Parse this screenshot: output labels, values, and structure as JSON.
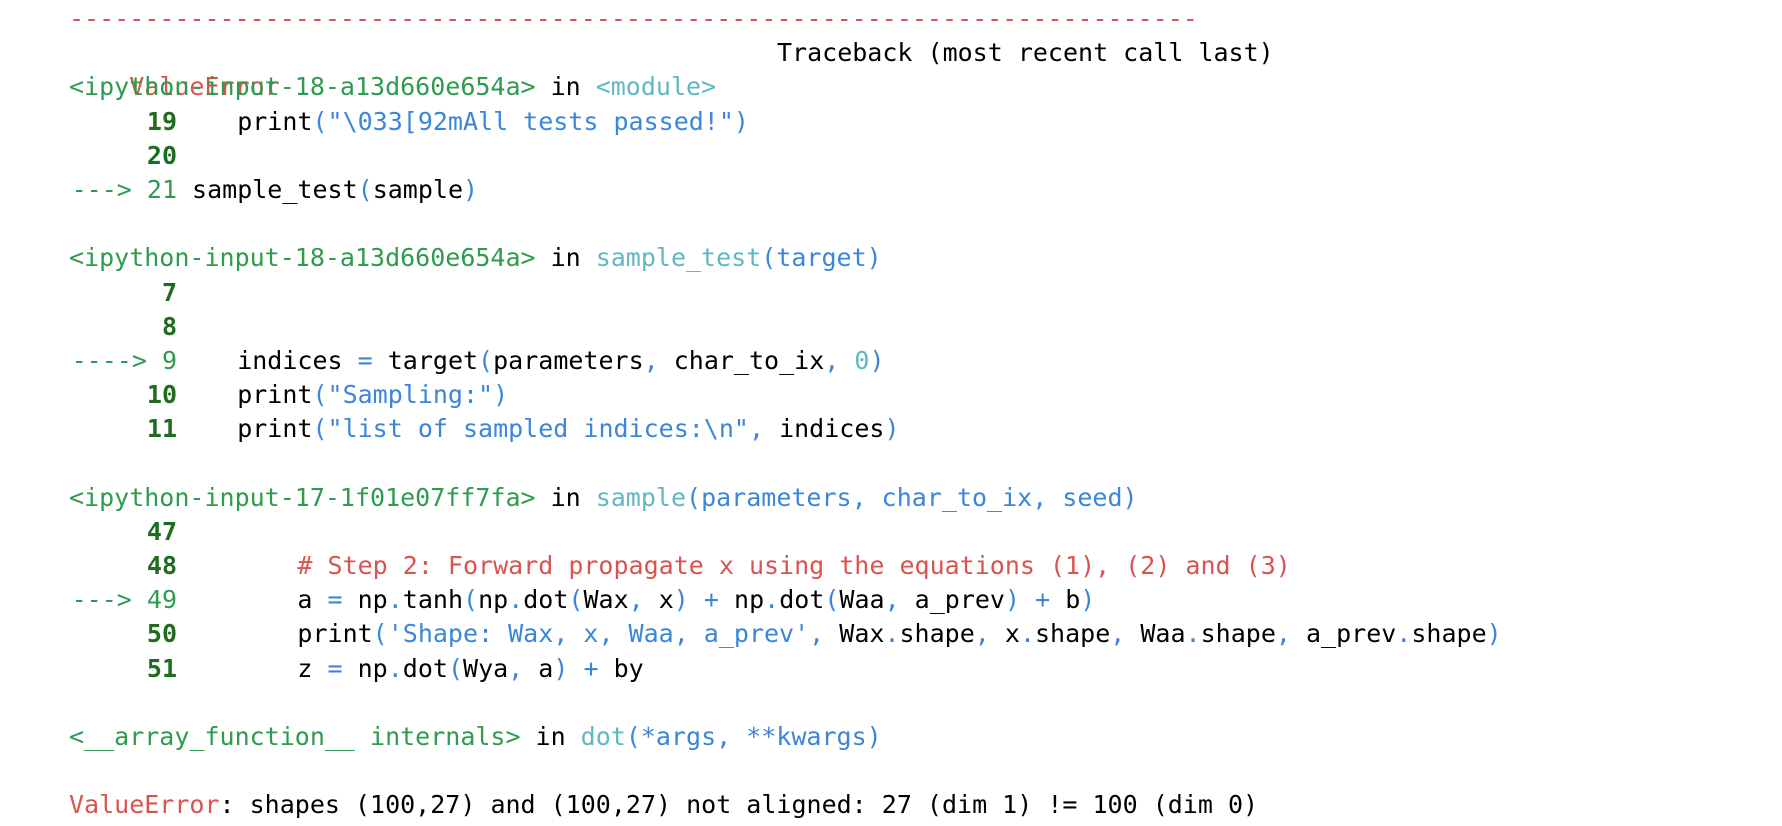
{
  "separator": "---------------------------------------------------------------------------",
  "error_name": "ValueError",
  "traceback_header": "Traceback (most recent call last)",
  "frames": [
    {
      "source": "<ipython-input-18-a13d660e654a>",
      "in_word": "in",
      "function": "<module>",
      "params": "",
      "lines": [
        {
          "arrow": "",
          "num": "19",
          "code": [
            {
              "t": "    print",
              "c": "blk"
            },
            {
              "t": "(\"\\033[92mAll tests passed!\")",
              "c": "blu"
            }
          ]
        },
        {
          "arrow": "",
          "num": "20",
          "code": []
        },
        {
          "arrow": "---> ",
          "num": "21",
          "current": true,
          "code": [
            {
              "t": " sample_test",
              "c": "blk"
            },
            {
              "t": "(",
              "c": "blu"
            },
            {
              "t": "sample",
              "c": "blk"
            },
            {
              "t": ")",
              "c": "blu"
            }
          ]
        }
      ]
    },
    {
      "source": "<ipython-input-18-a13d660e654a>",
      "in_word": "in",
      "function": "sample_test",
      "params": "(target)",
      "lines": [
        {
          "arrow": "",
          "num": "7",
          "code": []
        },
        {
          "arrow": "",
          "num": "8",
          "code": []
        },
        {
          "arrow": "----> ",
          "num": "9",
          "current": true,
          "code": [
            {
              "t": "    indices ",
              "c": "blk"
            },
            {
              "t": "=",
              "c": "blu"
            },
            {
              "t": " target",
              "c": "blk"
            },
            {
              "t": "(",
              "c": "blu"
            },
            {
              "t": "parameters",
              "c": "blk"
            },
            {
              "t": ",",
              "c": "blu"
            },
            {
              "t": " char_to_ix",
              "c": "blk"
            },
            {
              "t": ",",
              "c": "blu"
            },
            {
              "t": " 0",
              "c": "cyn"
            },
            {
              "t": ")",
              "c": "blu"
            }
          ]
        },
        {
          "arrow": "",
          "num": "10",
          "code": [
            {
              "t": "    print",
              "c": "blk"
            },
            {
              "t": "(\"Sampling:\")",
              "c": "blu"
            }
          ]
        },
        {
          "arrow": "",
          "num": "11",
          "code": [
            {
              "t": "    print",
              "c": "blk"
            },
            {
              "t": "(\"list of sampled indices:\\n\",",
              "c": "blu"
            },
            {
              "t": " indices",
              "c": "blk"
            },
            {
              "t": ")",
              "c": "blu"
            }
          ]
        }
      ]
    },
    {
      "source": "<ipython-input-17-1f01e07ff7fa>",
      "in_word": "in",
      "function": "sample",
      "params": "(parameters, char_to_ix, seed)",
      "lines": [
        {
          "arrow": "",
          "num": "47",
          "code": []
        },
        {
          "arrow": "",
          "num": "48",
          "code": [
            {
              "t": "        # Step 2: Forward propagate x using the equations (1), (2) and (3)",
              "c": "red"
            }
          ]
        },
        {
          "arrow": "---> ",
          "num": "49",
          "current": true,
          "code": [
            {
              "t": "        a ",
              "c": "blk"
            },
            {
              "t": "=",
              "c": "blu"
            },
            {
              "t": " np",
              "c": "blk"
            },
            {
              "t": ".",
              "c": "blu"
            },
            {
              "t": "tanh",
              "c": "blk"
            },
            {
              "t": "(",
              "c": "blu"
            },
            {
              "t": "np",
              "c": "blk"
            },
            {
              "t": ".",
              "c": "blu"
            },
            {
              "t": "dot",
              "c": "blk"
            },
            {
              "t": "(",
              "c": "blu"
            },
            {
              "t": "Wax",
              "c": "blk"
            },
            {
              "t": ",",
              "c": "blu"
            },
            {
              "t": " x",
              "c": "blk"
            },
            {
              "t": ")",
              "c": "blu"
            },
            {
              "t": " +",
              "c": "blu"
            },
            {
              "t": " np",
              "c": "blk"
            },
            {
              "t": ".",
              "c": "blu"
            },
            {
              "t": "dot",
              "c": "blk"
            },
            {
              "t": "(",
              "c": "blu"
            },
            {
              "t": "Waa",
              "c": "blk"
            },
            {
              "t": ",",
              "c": "blu"
            },
            {
              "t": " a_prev",
              "c": "blk"
            },
            {
              "t": ")",
              "c": "blu"
            },
            {
              "t": " +",
              "c": "blu"
            },
            {
              "t": " b",
              "c": "blk"
            },
            {
              "t": ")",
              "c": "blu"
            }
          ]
        },
        {
          "arrow": "",
          "num": "50",
          "code": [
            {
              "t": "        print",
              "c": "blk"
            },
            {
              "t": "('Shape: Wax, x, Waa, a_prev',",
              "c": "blu"
            },
            {
              "t": " Wax",
              "c": "blk"
            },
            {
              "t": ".",
              "c": "blu"
            },
            {
              "t": "shape",
              "c": "blk"
            },
            {
              "t": ",",
              "c": "blu"
            },
            {
              "t": " x",
              "c": "blk"
            },
            {
              "t": ".",
              "c": "blu"
            },
            {
              "t": "shape",
              "c": "blk"
            },
            {
              "t": ",",
              "c": "blu"
            },
            {
              "t": " Waa",
              "c": "blk"
            },
            {
              "t": ".",
              "c": "blu"
            },
            {
              "t": "shape",
              "c": "blk"
            },
            {
              "t": ",",
              "c": "blu"
            },
            {
              "t": " a_prev",
              "c": "blk"
            },
            {
              "t": ".",
              "c": "blu"
            },
            {
              "t": "shape",
              "c": "blk"
            },
            {
              "t": ")",
              "c": "blu"
            }
          ]
        },
        {
          "arrow": "",
          "num": "51",
          "code": [
            {
              "t": "        z ",
              "c": "blk"
            },
            {
              "t": "=",
              "c": "blu"
            },
            {
              "t": " np",
              "c": "blk"
            },
            {
              "t": ".",
              "c": "blu"
            },
            {
              "t": "dot",
              "c": "blk"
            },
            {
              "t": "(",
              "c": "blu"
            },
            {
              "t": "Wya",
              "c": "blk"
            },
            {
              "t": ",",
              "c": "blu"
            },
            {
              "t": " a",
              "c": "blk"
            },
            {
              "t": ")",
              "c": "blu"
            },
            {
              "t": " +",
              "c": "blu"
            },
            {
              "t": " by",
              "c": "blk"
            }
          ]
        }
      ]
    },
    {
      "source": "<__array_function__ internals>",
      "in_word": "in",
      "function": "dot",
      "params": "(*args, **kwargs)",
      "lines": []
    }
  ],
  "final_error": {
    "name": "ValueError",
    "message": ": shapes (100,27) and (100,27) not aligned: 27 (dim 1) != 100 (dim 0)"
  }
}
